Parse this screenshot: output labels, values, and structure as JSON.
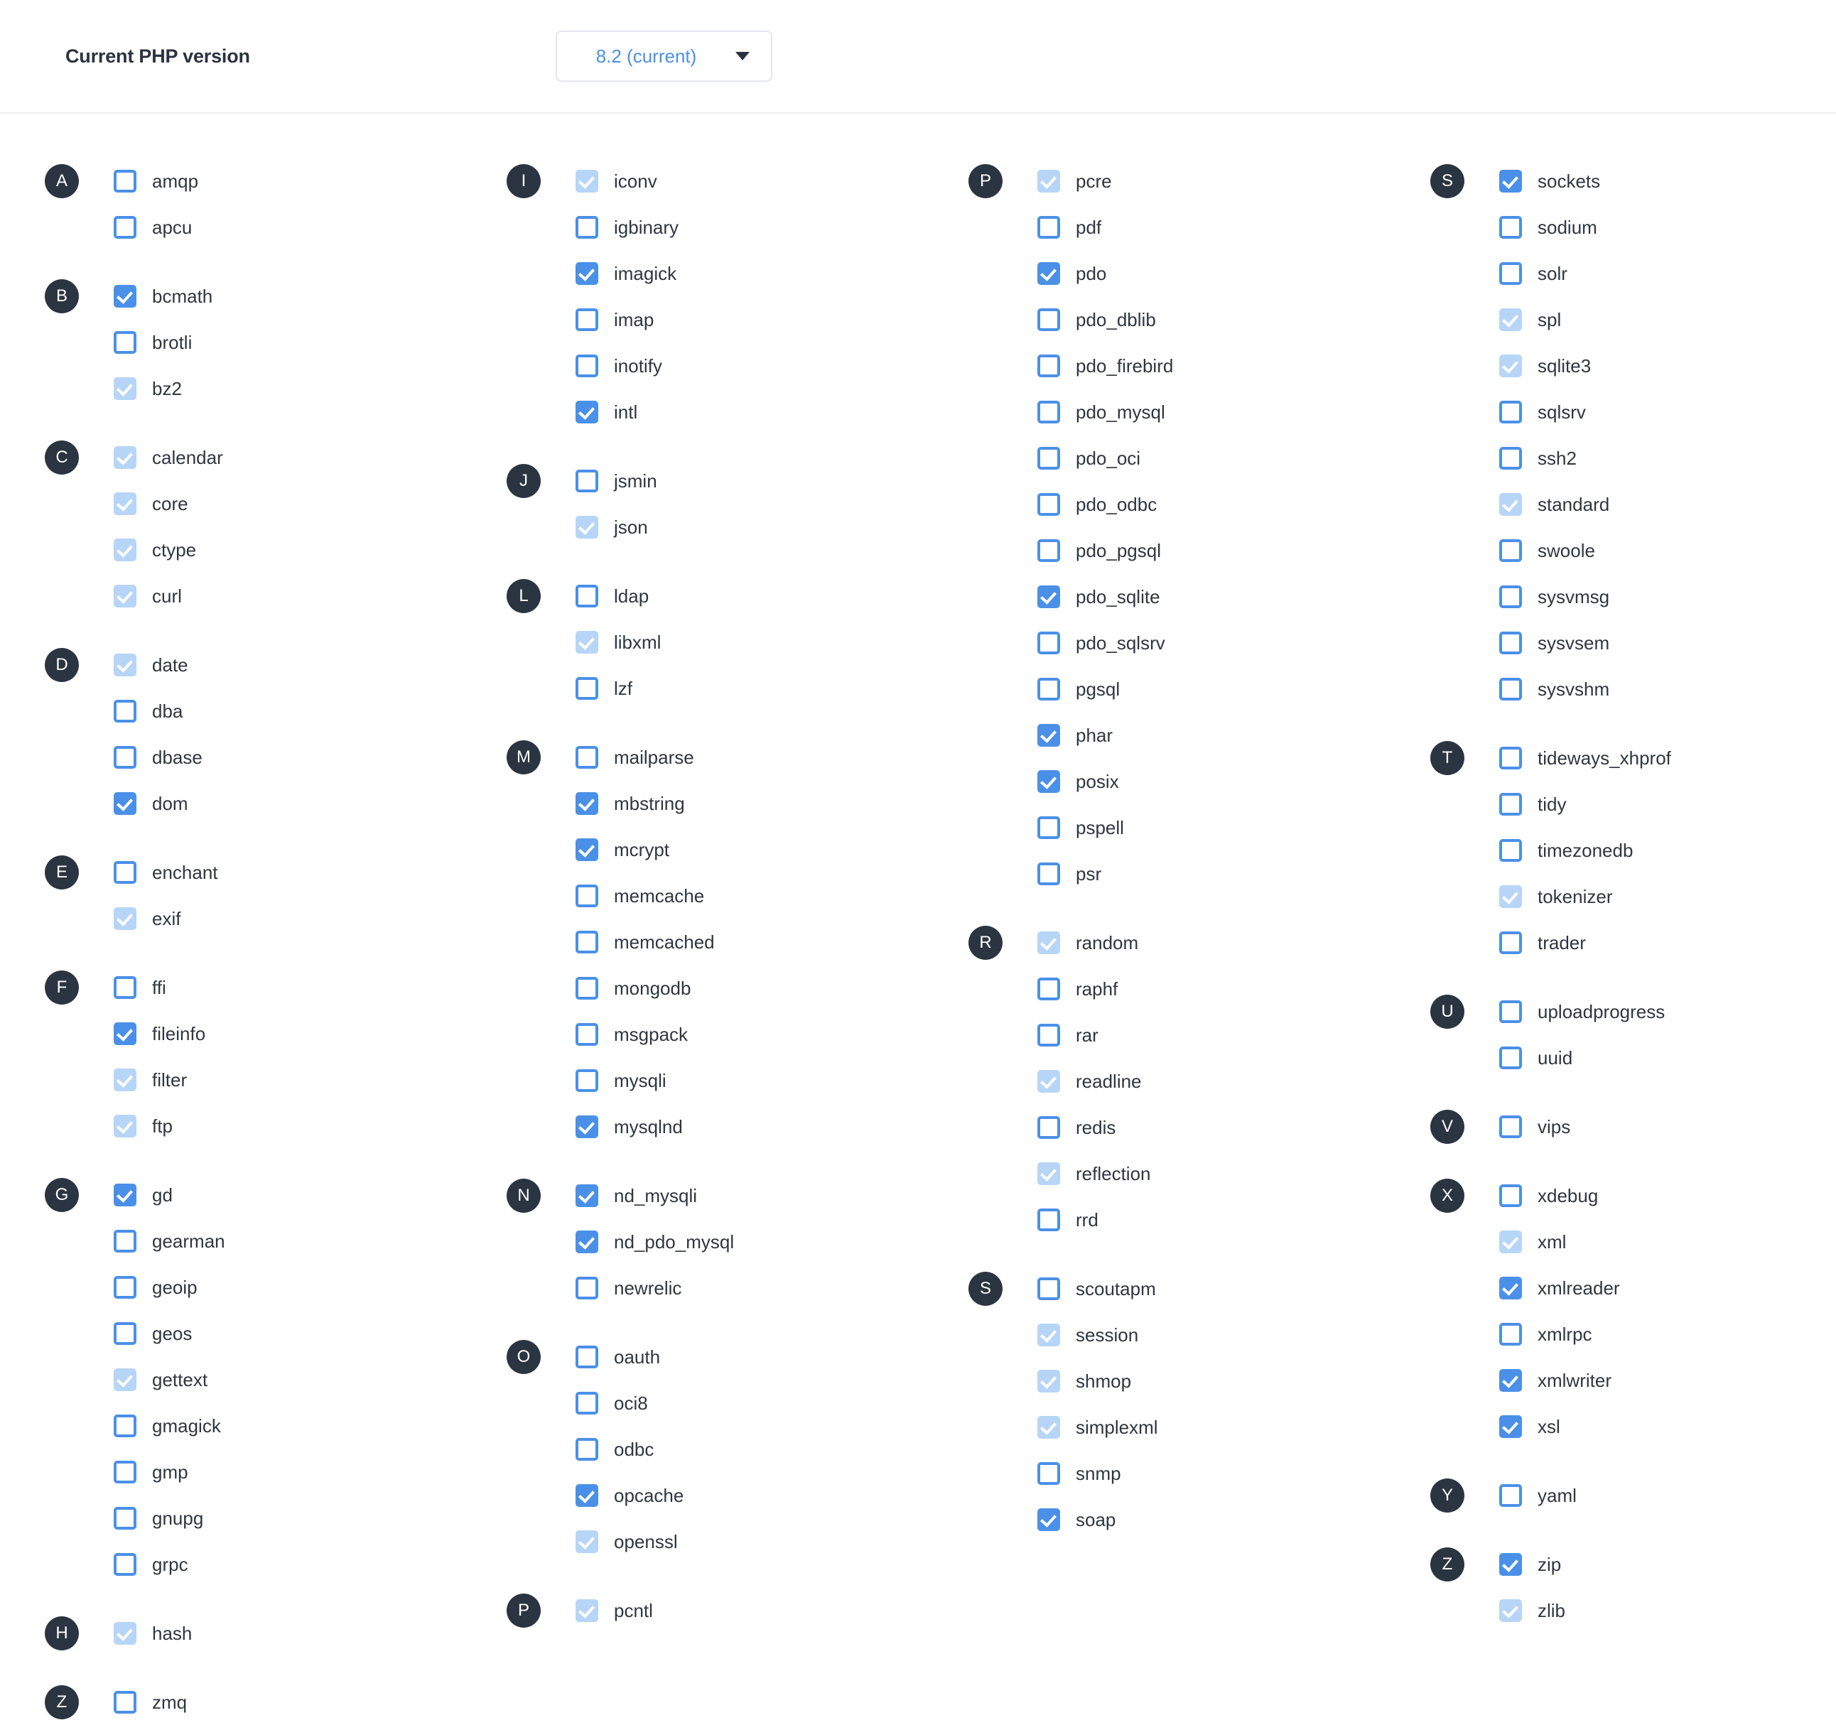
{
  "header": {
    "label": "Current PHP version",
    "version_value": "8.2 (current)",
    "caret_icon": "chevron-down-icon"
  },
  "legend": {
    "state_unchecked": "unchecked",
    "state_checked": "checked",
    "state_locked": "checked-disabled"
  },
  "colors": {
    "accent": "#4a90e8",
    "locked": "#b7d5f6",
    "badge": "#2b3541",
    "text": "#2f3640",
    "divider": "#edeff2"
  },
  "columns": [
    {
      "groups": [
        {
          "letter": "A",
          "items": [
            {
              "name": "amqp",
              "state": "unchecked"
            },
            {
              "name": "apcu",
              "state": "unchecked"
            }
          ]
        },
        {
          "letter": "B",
          "items": [
            {
              "name": "bcmath",
              "state": "checked"
            },
            {
              "name": "brotli",
              "state": "unchecked"
            },
            {
              "name": "bz2",
              "state": "locked"
            }
          ]
        },
        {
          "letter": "C",
          "items": [
            {
              "name": "calendar",
              "state": "locked"
            },
            {
              "name": "core",
              "state": "locked"
            },
            {
              "name": "ctype",
              "state": "locked"
            },
            {
              "name": "curl",
              "state": "locked"
            }
          ]
        },
        {
          "letter": "D",
          "items": [
            {
              "name": "date",
              "state": "locked"
            },
            {
              "name": "dba",
              "state": "unchecked"
            },
            {
              "name": "dbase",
              "state": "unchecked"
            },
            {
              "name": "dom",
              "state": "checked"
            }
          ]
        },
        {
          "letter": "E",
          "items": [
            {
              "name": "enchant",
              "state": "unchecked"
            },
            {
              "name": "exif",
              "state": "locked"
            }
          ]
        },
        {
          "letter": "F",
          "items": [
            {
              "name": "ffi",
              "state": "unchecked"
            },
            {
              "name": "fileinfo",
              "state": "checked"
            },
            {
              "name": "filter",
              "state": "locked"
            },
            {
              "name": "ftp",
              "state": "locked"
            }
          ]
        },
        {
          "letter": "G",
          "items": [
            {
              "name": "gd",
              "state": "checked"
            },
            {
              "name": "gearman",
              "state": "unchecked"
            },
            {
              "name": "geoip",
              "state": "unchecked"
            },
            {
              "name": "geos",
              "state": "unchecked"
            },
            {
              "name": "gettext",
              "state": "locked"
            },
            {
              "name": "gmagick",
              "state": "unchecked"
            },
            {
              "name": "gmp",
              "state": "unchecked"
            },
            {
              "name": "gnupg",
              "state": "unchecked"
            },
            {
              "name": "grpc",
              "state": "unchecked"
            }
          ]
        },
        {
          "letter": "H",
          "items": [
            {
              "name": "hash",
              "state": "locked"
            }
          ]
        },
        {
          "letter": "Z",
          "items": [
            {
              "name": "zmq",
              "state": "unchecked"
            }
          ]
        }
      ]
    },
    {
      "groups": [
        {
          "letter": "I",
          "items": [
            {
              "name": "iconv",
              "state": "locked"
            },
            {
              "name": "igbinary",
              "state": "unchecked"
            },
            {
              "name": "imagick",
              "state": "checked"
            },
            {
              "name": "imap",
              "state": "unchecked"
            },
            {
              "name": "inotify",
              "state": "unchecked"
            },
            {
              "name": "intl",
              "state": "checked"
            }
          ]
        },
        {
          "letter": "J",
          "items": [
            {
              "name": "jsmin",
              "state": "unchecked"
            },
            {
              "name": "json",
              "state": "locked"
            }
          ]
        },
        {
          "letter": "L",
          "items": [
            {
              "name": "ldap",
              "state": "unchecked"
            },
            {
              "name": "libxml",
              "state": "locked"
            },
            {
              "name": "lzf",
              "state": "unchecked"
            }
          ]
        },
        {
          "letter": "M",
          "items": [
            {
              "name": "mailparse",
              "state": "unchecked"
            },
            {
              "name": "mbstring",
              "state": "checked"
            },
            {
              "name": "mcrypt",
              "state": "checked"
            },
            {
              "name": "memcache",
              "state": "unchecked"
            },
            {
              "name": "memcached",
              "state": "unchecked"
            },
            {
              "name": "mongodb",
              "state": "unchecked"
            },
            {
              "name": "msgpack",
              "state": "unchecked"
            },
            {
              "name": "mysqli",
              "state": "unchecked"
            },
            {
              "name": "mysqlnd",
              "state": "checked"
            }
          ]
        },
        {
          "letter": "N",
          "items": [
            {
              "name": "nd_mysqli",
              "state": "checked"
            },
            {
              "name": "nd_pdo_mysql",
              "state": "checked"
            },
            {
              "name": "newrelic",
              "state": "unchecked"
            }
          ]
        },
        {
          "letter": "O",
          "items": [
            {
              "name": "oauth",
              "state": "unchecked"
            },
            {
              "name": "oci8",
              "state": "unchecked"
            },
            {
              "name": "odbc",
              "state": "unchecked"
            },
            {
              "name": "opcache",
              "state": "checked"
            },
            {
              "name": "openssl",
              "state": "locked"
            }
          ]
        },
        {
          "letter": "P",
          "items": [
            {
              "name": "pcntl",
              "state": "locked"
            }
          ]
        }
      ]
    },
    {
      "groups": [
        {
          "letter": "P",
          "items": [
            {
              "name": "pcre",
              "state": "locked"
            },
            {
              "name": "pdf",
              "state": "unchecked"
            },
            {
              "name": "pdo",
              "state": "checked"
            },
            {
              "name": "pdo_dblib",
              "state": "unchecked"
            },
            {
              "name": "pdo_firebird",
              "state": "unchecked"
            },
            {
              "name": "pdo_mysql",
              "state": "unchecked"
            },
            {
              "name": "pdo_oci",
              "state": "unchecked"
            },
            {
              "name": "pdo_odbc",
              "state": "unchecked"
            },
            {
              "name": "pdo_pgsql",
              "state": "unchecked"
            },
            {
              "name": "pdo_sqlite",
              "state": "checked"
            },
            {
              "name": "pdo_sqlsrv",
              "state": "unchecked"
            },
            {
              "name": "pgsql",
              "state": "unchecked"
            },
            {
              "name": "phar",
              "state": "checked"
            },
            {
              "name": "posix",
              "state": "checked"
            },
            {
              "name": "pspell",
              "state": "unchecked"
            },
            {
              "name": "psr",
              "state": "unchecked"
            }
          ]
        },
        {
          "letter": "R",
          "items": [
            {
              "name": "random",
              "state": "locked"
            },
            {
              "name": "raphf",
              "state": "unchecked"
            },
            {
              "name": "rar",
              "state": "unchecked"
            },
            {
              "name": "readline",
              "state": "locked"
            },
            {
              "name": "redis",
              "state": "unchecked"
            },
            {
              "name": "reflection",
              "state": "locked"
            },
            {
              "name": "rrd",
              "state": "unchecked"
            }
          ]
        },
        {
          "letter": "S",
          "items": [
            {
              "name": "scoutapm",
              "state": "unchecked"
            },
            {
              "name": "session",
              "state": "locked"
            },
            {
              "name": "shmop",
              "state": "locked"
            },
            {
              "name": "simplexml",
              "state": "locked"
            },
            {
              "name": "snmp",
              "state": "unchecked"
            },
            {
              "name": "soap",
              "state": "checked"
            }
          ]
        }
      ]
    },
    {
      "groups": [
        {
          "letter": "S",
          "items": [
            {
              "name": "sockets",
              "state": "checked"
            },
            {
              "name": "sodium",
              "state": "unchecked"
            },
            {
              "name": "solr",
              "state": "unchecked"
            },
            {
              "name": "spl",
              "state": "locked"
            },
            {
              "name": "sqlite3",
              "state": "locked"
            },
            {
              "name": "sqlsrv",
              "state": "unchecked"
            },
            {
              "name": "ssh2",
              "state": "unchecked"
            },
            {
              "name": "standard",
              "state": "locked"
            },
            {
              "name": "swoole",
              "state": "unchecked"
            },
            {
              "name": "sysvmsg",
              "state": "unchecked"
            },
            {
              "name": "sysvsem",
              "state": "unchecked"
            },
            {
              "name": "sysvshm",
              "state": "unchecked"
            }
          ]
        },
        {
          "letter": "T",
          "items": [
            {
              "name": "tideways_xhprof",
              "state": "unchecked"
            },
            {
              "name": "tidy",
              "state": "unchecked"
            },
            {
              "name": "timezonedb",
              "state": "unchecked"
            },
            {
              "name": "tokenizer",
              "state": "locked"
            },
            {
              "name": "trader",
              "state": "unchecked"
            }
          ]
        },
        {
          "letter": "U",
          "items": [
            {
              "name": "uploadprogress",
              "state": "unchecked"
            },
            {
              "name": "uuid",
              "state": "unchecked"
            }
          ]
        },
        {
          "letter": "V",
          "items": [
            {
              "name": "vips",
              "state": "unchecked"
            }
          ]
        },
        {
          "letter": "X",
          "items": [
            {
              "name": "xdebug",
              "state": "unchecked"
            },
            {
              "name": "xml",
              "state": "locked"
            },
            {
              "name": "xmlreader",
              "state": "checked"
            },
            {
              "name": "xmlrpc",
              "state": "unchecked"
            },
            {
              "name": "xmlwriter",
              "state": "checked"
            },
            {
              "name": "xsl",
              "state": "checked"
            }
          ]
        },
        {
          "letter": "Y",
          "items": [
            {
              "name": "yaml",
              "state": "unchecked"
            }
          ]
        },
        {
          "letter": "Z",
          "items": [
            {
              "name": "zip",
              "state": "checked"
            },
            {
              "name": "zlib",
              "state": "locked"
            }
          ]
        }
      ]
    }
  ]
}
